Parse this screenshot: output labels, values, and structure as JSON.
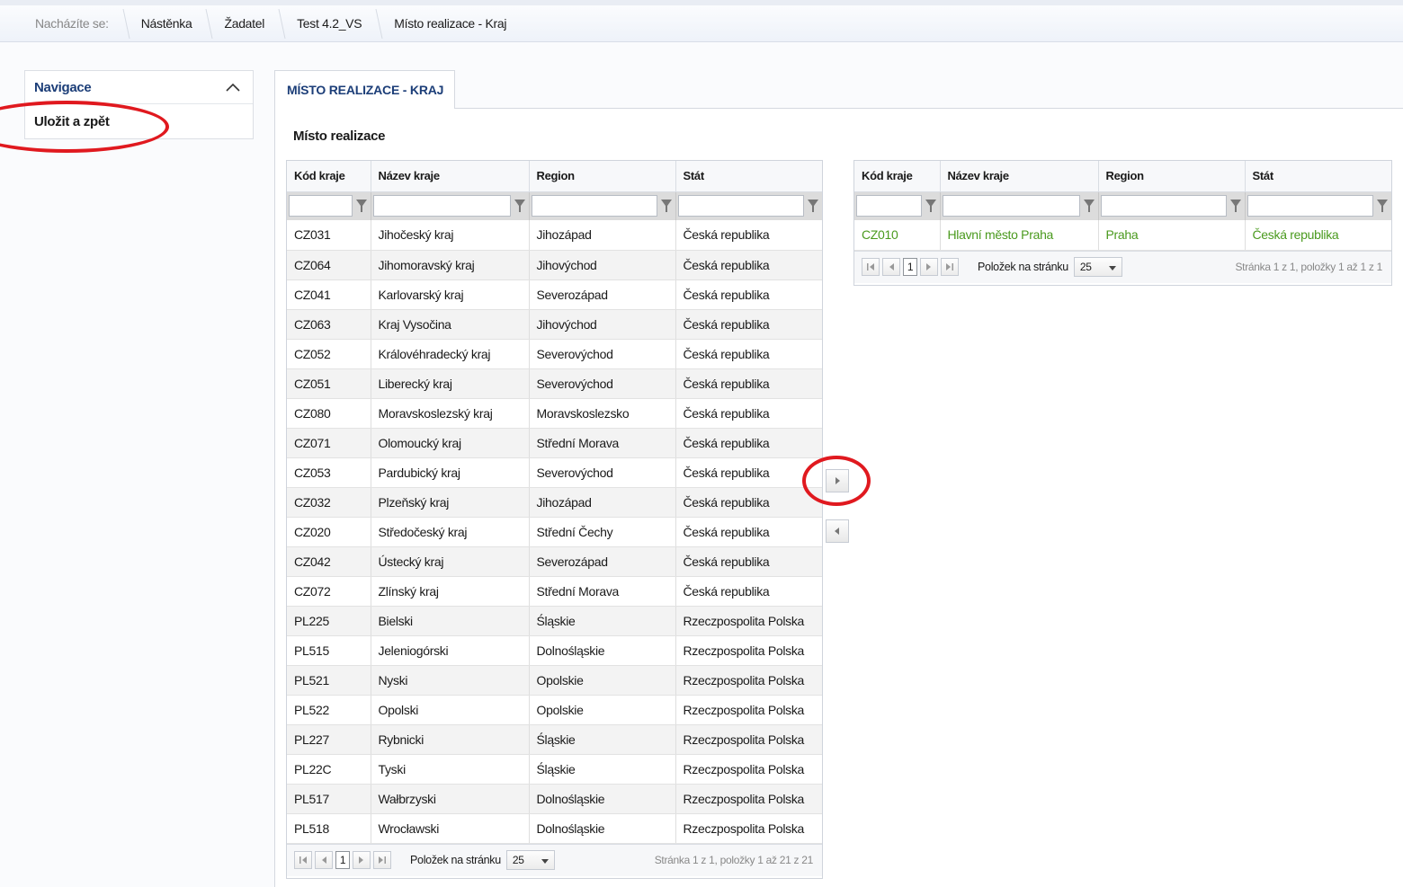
{
  "breadcrumb": {
    "prefix": "Nacházíte se:",
    "items": [
      "Nástěnka",
      "Žadatel",
      "Test 4.2_VS",
      "Místo realizace - Kraj"
    ]
  },
  "navigation": {
    "title": "Navigace",
    "items": [
      {
        "label": "Uložit a zpět"
      }
    ]
  },
  "tab": {
    "label": "MÍSTO REALIZACE - KRAJ"
  },
  "section": {
    "title": "Místo realizace"
  },
  "columns": [
    "Kód kraje",
    "Název kraje",
    "Region",
    "Stát"
  ],
  "available_grid": {
    "rows": [
      [
        "CZ031",
        "Jihočeský kraj",
        "Jihozápad",
        "Česká republika"
      ],
      [
        "CZ064",
        "Jihomoravský kraj",
        "Jihovýchod",
        "Česká republika"
      ],
      [
        "CZ041",
        "Karlovarský kraj",
        "Severozápad",
        "Česká republika"
      ],
      [
        "CZ063",
        "Kraj Vysočina",
        "Jihovýchod",
        "Česká republika"
      ],
      [
        "CZ052",
        "Královéhradecký kraj",
        "Severovýchod",
        "Česká republika"
      ],
      [
        "CZ051",
        "Liberecký kraj",
        "Severovýchod",
        "Česká republika"
      ],
      [
        "CZ080",
        "Moravskoslezský kraj",
        "Moravskoslezsko",
        "Česká republika"
      ],
      [
        "CZ071",
        "Olomoucký kraj",
        "Střední Morava",
        "Česká republika"
      ],
      [
        "CZ053",
        "Pardubický kraj",
        "Severovýchod",
        "Česká republika"
      ],
      [
        "CZ032",
        "Plzeňský kraj",
        "Jihozápad",
        "Česká republika"
      ],
      [
        "CZ020",
        "Středočeský kraj",
        "Střední Čechy",
        "Česká republika"
      ],
      [
        "CZ042",
        "Ústecký kraj",
        "Severozápad",
        "Česká republika"
      ],
      [
        "CZ072",
        "Zlínský kraj",
        "Střední Morava",
        "Česká republika"
      ],
      [
        "PL225",
        "Bielski",
        "Śląskie",
        "Rzeczpospolita Polska"
      ],
      [
        "PL515",
        "Jeleniogórski",
        "Dolnośląskie",
        "Rzeczpospolita Polska"
      ],
      [
        "PL521",
        "Nyski",
        "Opolskie",
        "Rzeczpospolita Polska"
      ],
      [
        "PL522",
        "Opolski",
        "Opolskie",
        "Rzeczpospolita Polska"
      ],
      [
        "PL227",
        "Rybnicki",
        "Śląskie",
        "Rzeczpospolita Polska"
      ],
      [
        "PL22C",
        "Tyski",
        "Śląskie",
        "Rzeczpospolita Polska"
      ],
      [
        "PL517",
        "Wałbrzyski",
        "Dolnośląskie",
        "Rzeczpospolita Polska"
      ],
      [
        "PL518",
        "Wrocławski",
        "Dolnośląskie",
        "Rzeczpospolita Polska"
      ]
    ],
    "pager": {
      "page": "1",
      "per_page_label": "Položek na stránku",
      "per_page": "25",
      "info": "Stránka 1 z 1, položky 1 až 21 z 21"
    }
  },
  "selected_grid": {
    "rows": [
      [
        "CZ010",
        "Hlavní město Praha",
        "Praha",
        "Česká republika"
      ]
    ],
    "pager": {
      "page": "1",
      "per_page_label": "Položek na stránku",
      "per_page": "25",
      "info": "Stránka 1 z 1, položky 1 až 1 z 1"
    }
  },
  "colors": {
    "nav_title": "#1c3e78",
    "selected_row_text": "#4a9a1e",
    "annotation_red": "#e0191f"
  }
}
